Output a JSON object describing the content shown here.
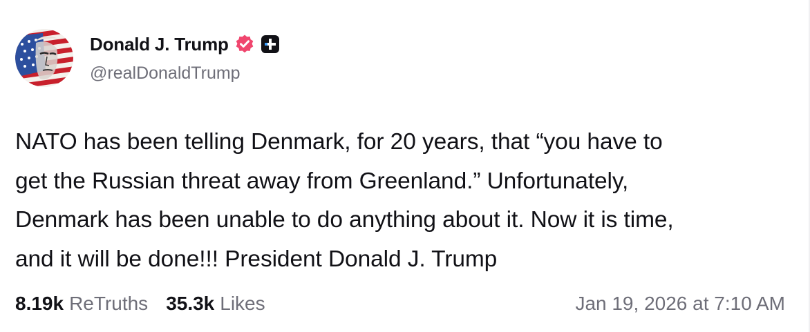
{
  "post": {
    "author": {
      "display_name": "Donald J. Trump",
      "handle": "@realDonaldTrump",
      "verified_icon": "verified-badge-icon",
      "plus_icon": "truth-plus-icon"
    },
    "text": "NATO has been telling Denmark, for 20 years, that “you have to\nget the Russian threat away from Greenland.” Unfortunately,\nDenmark has been unable to do anything about it. Now it is time,\nand it will be done!!! President Donald J. Trump",
    "stats": {
      "retruths_count": "8.19k",
      "retruths_label": "ReTruths",
      "likes_count": "35.3k",
      "likes_label": "Likes"
    },
    "timestamp": "Jan 19, 2026 at 7:10 AM"
  },
  "colors": {
    "verified_badge": "#f0466e",
    "text_primary": "#111116",
    "text_secondary": "#6e6e78"
  }
}
